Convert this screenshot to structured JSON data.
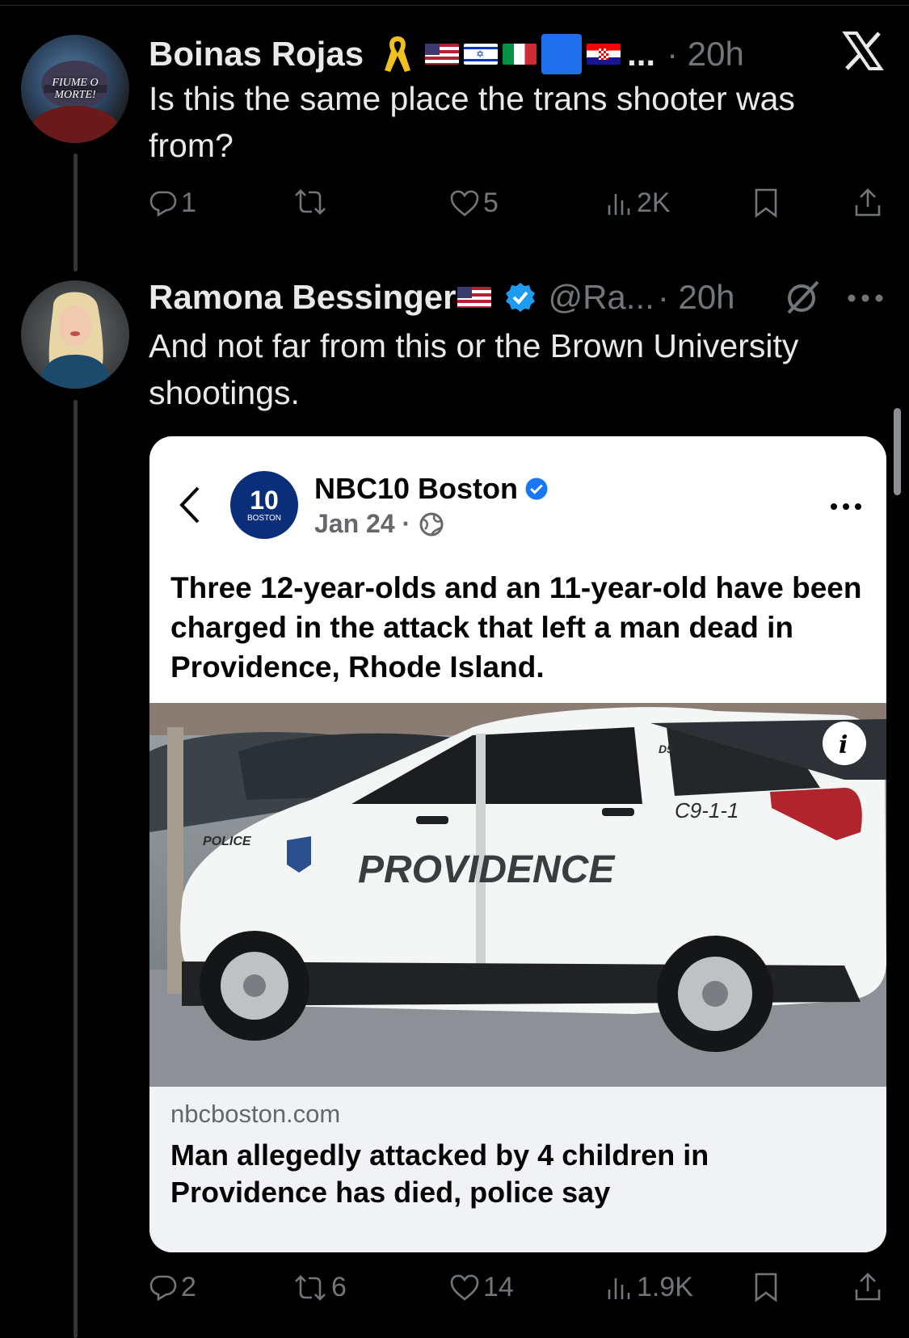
{
  "tweet1": {
    "name": "Boinas Rojas",
    "dots": "...",
    "time": "· 20h",
    "text": "Is this the same place the trans shooter was from?",
    "avatar_text_line1": "FIUME O",
    "avatar_text_line2": "MORTE!",
    "replies": "1",
    "likes": "5",
    "views": "2K"
  },
  "tweet2": {
    "name": "Ramona Bessinger",
    "handle": "@Ra...",
    "time": "· 20h",
    "text": "And not far from this or the Brown University shootings.",
    "replies": "2",
    "retweets": "6",
    "likes": "14",
    "views": "1.9K"
  },
  "embed": {
    "page_name": "NBC10 Boston",
    "logo_number": "10",
    "logo_sub": "BOSTON",
    "date": "Jan 24 ·",
    "post_text": "Three 12-year-olds and an 11-year-old have been charged in the attack that left a man dead in Providence, Rhode Island.",
    "photo_labels": {
      "providence": "PROVIDENCE",
      "police": "POLICE",
      "unit": "D5",
      "phone": "C9-1-1"
    },
    "domain": "nbcboston.com",
    "headline": "Man allegedly attacked by 4 children in Providence has died, police say"
  },
  "colors": {
    "background": "#000000",
    "text": "#e7e9ea",
    "muted": "#71767b",
    "verified": "#1d9bf0"
  },
  "icons": [
    "x-logo-icon",
    "ribbon-icon",
    "verified-icon",
    "grok-icon",
    "more-icon",
    "reply-icon",
    "retweet-icon",
    "like-icon",
    "views-icon",
    "bookmark-icon",
    "share-icon",
    "back-arrow-icon",
    "globe-icon",
    "info-icon"
  ]
}
